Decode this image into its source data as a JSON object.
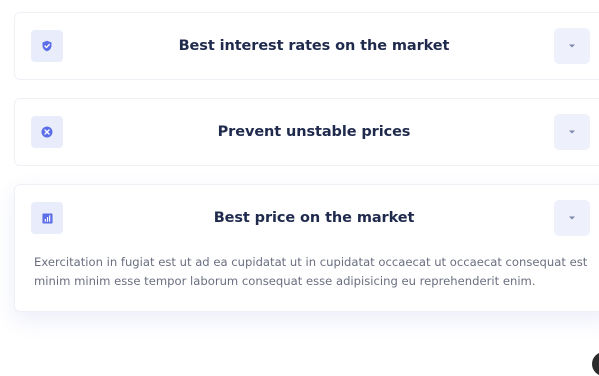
{
  "accordion": {
    "items": [
      {
        "title": "Best interest rates on the market",
        "icon": "shield-check-icon",
        "expanded": false,
        "body": ""
      },
      {
        "title": "Prevent unstable prices",
        "icon": "close-circle-icon",
        "expanded": false,
        "body": ""
      },
      {
        "title": "Best price on the market",
        "icon": "bar-chart-icon",
        "expanded": true,
        "body": "Exercitation in fugiat est ut ad ea cupidatat ut in cupidatat occaecat ut occaecat consequat est minim minim esse tempor laborum consequat esse adipisicing eu reprehenderit enim."
      }
    ],
    "toggle_icon": "caret-down-icon"
  },
  "colors": {
    "accent": "#5b6ee8",
    "title": "#1f2a4d",
    "body_text": "#6a6f80",
    "icon_bg": "#e9ecfb",
    "toggle_bg": "#eef0fc"
  }
}
